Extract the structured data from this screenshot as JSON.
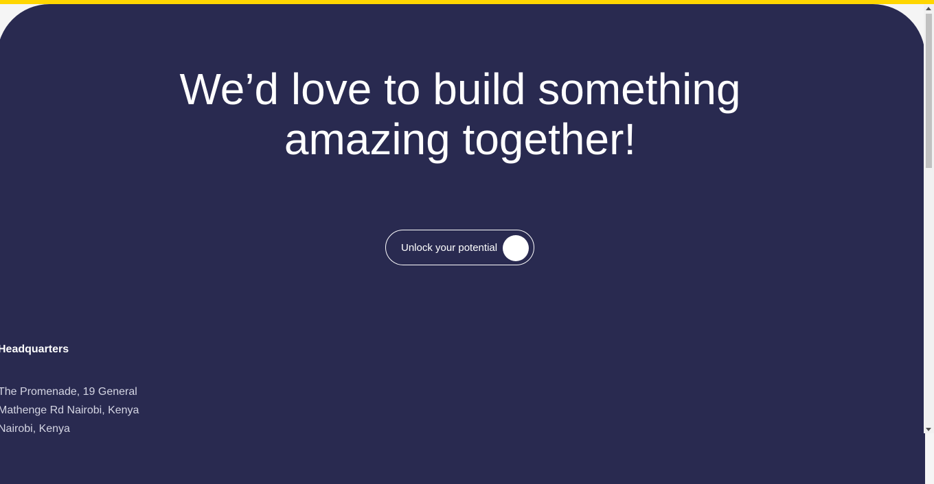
{
  "colors": {
    "accent_bar": "#ffd600",
    "hero_background": "#292a50",
    "text_primary": "#ffffff",
    "text_secondary": "#d4d5e3"
  },
  "hero": {
    "headline_line1": "We’d love to build something",
    "headline_line2": "amazing together!",
    "cta_label": "Unlock your potential"
  },
  "headquarters": {
    "title": "Headquarters",
    "address_lines": [
      "The Promenade, 19 General",
      "Mathenge Rd Nairobi, Kenya",
      "Nairobi, Kenya"
    ]
  }
}
